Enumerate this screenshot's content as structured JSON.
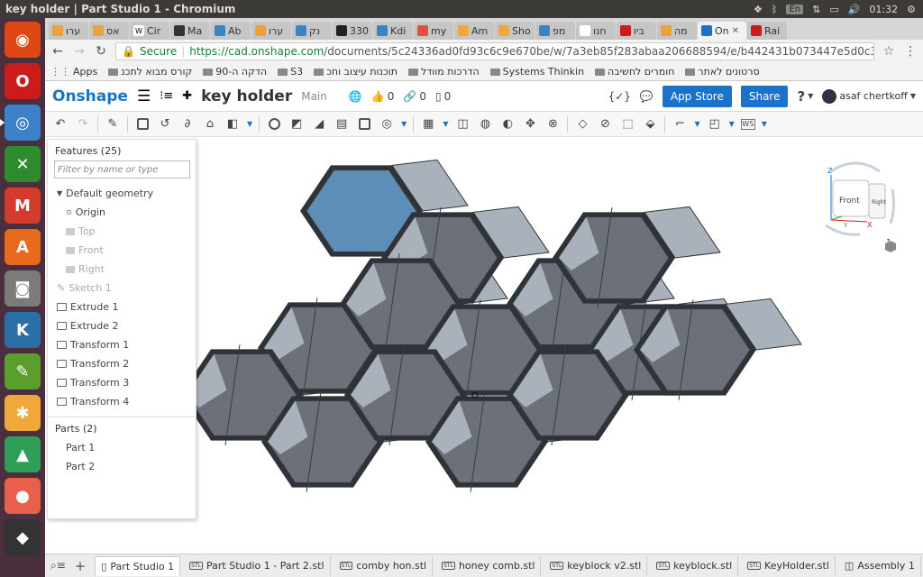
{
  "system": {
    "window_title": "key holder | Part Studio 1 - Chromium",
    "lang": "En",
    "clock": "01:32"
  },
  "launcher": {
    "items": [
      {
        "name": "ubuntu-icon",
        "color": "#dd4814",
        "glyph": "◉"
      },
      {
        "name": "opera-icon",
        "color": "#cc1b1b",
        "glyph": "O"
      },
      {
        "name": "chromium-icon",
        "color": "#3b82c8",
        "glyph": "◎"
      },
      {
        "name": "xmind-icon",
        "color": "#2e8b2e",
        "glyph": "✕"
      },
      {
        "name": "gmail-icon",
        "color": "#d33b2c",
        "glyph": "M"
      },
      {
        "name": "software-center-icon",
        "color": "#e86a1c",
        "glyph": "A"
      },
      {
        "name": "camera-icon",
        "color": "#7b7b7b",
        "glyph": "◙"
      },
      {
        "name": "kodi-icon",
        "color": "#2a6fa8",
        "glyph": "K"
      },
      {
        "name": "paint-icon",
        "color": "#5a9e2e",
        "glyph": "✎"
      },
      {
        "name": "photos-icon",
        "color": "#f0a83a",
        "glyph": "✱"
      },
      {
        "name": "drive-icon",
        "color": "#2f9e57",
        "glyph": "▲"
      },
      {
        "name": "asana-icon",
        "color": "#e8604c",
        "glyph": "●"
      },
      {
        "name": "inkscape-icon",
        "color": "#333",
        "glyph": "◆"
      }
    ]
  },
  "tabs": [
    {
      "label": "ערו",
      "color": "#e8a33a"
    },
    {
      "label": "אס",
      "color": "#e8a33a"
    },
    {
      "label": "Cir",
      "color": "#fff",
      "glyph": "W"
    },
    {
      "label": "Ma",
      "color": "#333"
    },
    {
      "label": "Ab",
      "color": "#3b82c8"
    },
    {
      "label": "ערו",
      "color": "#e8a33a"
    },
    {
      "label": "נק",
      "color": "#3b82c8"
    },
    {
      "label": "330",
      "color": "#222"
    },
    {
      "label": "Kdi",
      "color": "#3b82c8"
    },
    {
      "label": "my",
      "color": "#e84c3c"
    },
    {
      "label": "Am",
      "color": "#f0a83a"
    },
    {
      "label": "Sho",
      "color": "#f0a83a"
    },
    {
      "label": "מפ",
      "color": "#3b82c8"
    },
    {
      "label": "חנו",
      "color": "#fff"
    },
    {
      "label": "ביו",
      "color": "#cc1b1b"
    },
    {
      "label": "מה",
      "color": "#e8a33a"
    },
    {
      "label": "On",
      "color": "#1a73c8",
      "active": true
    },
    {
      "label": "Rai",
      "color": "#cc1b1b"
    }
  ],
  "address": {
    "secure_label": "Secure",
    "url_host": "https://cad.onshape.com",
    "url_path": "/documents/5c24336ad0fd93c6c9e670be/w/7a3eb85f283abaa206688594/e/b442431b073447e5d0c3b4b4"
  },
  "bookmarks": [
    {
      "label": "Apps"
    },
    {
      "label": "קורס מבוא לתכנ"
    },
    {
      "label": "הדקה ה-90"
    },
    {
      "label": "S3"
    },
    {
      "label": "תוכנות עיצוב וחכ"
    },
    {
      "label": "הדרכות מוודל"
    },
    {
      "label": "Systems Thinkin"
    },
    {
      "label": "חומרים לחשיבה"
    },
    {
      "label": "סרטונים לאתר"
    }
  ],
  "onshape": {
    "logo": "Onshape",
    "doc_name": "key holder",
    "branch": "Main",
    "likes": "0",
    "links": "0",
    "copies": "0",
    "app_store": "App Store",
    "share": "Share",
    "help": "?",
    "user": "asaf chertkoff"
  },
  "features": {
    "header": "Features (25)",
    "filter_placeholder": "Filter by name or type",
    "default_geometry": "Default geometry",
    "origin": "Origin",
    "planes": [
      "Top",
      "Front",
      "Right"
    ],
    "items": [
      "Sketch 1",
      "Extrude 1",
      "Extrude 2",
      "Transform 1",
      "Transform 2",
      "Transform 3",
      "Transform 4"
    ],
    "parts_header": "Parts (2)",
    "parts": [
      "Part 1",
      "Part 2"
    ]
  },
  "viewcube": {
    "front": "Front",
    "right": "Right",
    "z": "Z",
    "y": "Y",
    "x": "X"
  },
  "bottom_tabs": [
    {
      "label": "Part Studio 1",
      "active": true
    },
    {
      "label": "Part Studio 1 - Part 2.stl"
    },
    {
      "label": "comby hon.stl"
    },
    {
      "label": "honey comb.stl"
    },
    {
      "label": "keyblock v2.stl"
    },
    {
      "label": "keyblock.stl"
    },
    {
      "label": "KeyHolder.stl"
    },
    {
      "label": "Assembly 1"
    }
  ],
  "model": {
    "face_color": "#6b7079",
    "side_color": "#a9b1bb",
    "selected_color": "#5d8eb8",
    "edge_color": "#2f3338"
  }
}
